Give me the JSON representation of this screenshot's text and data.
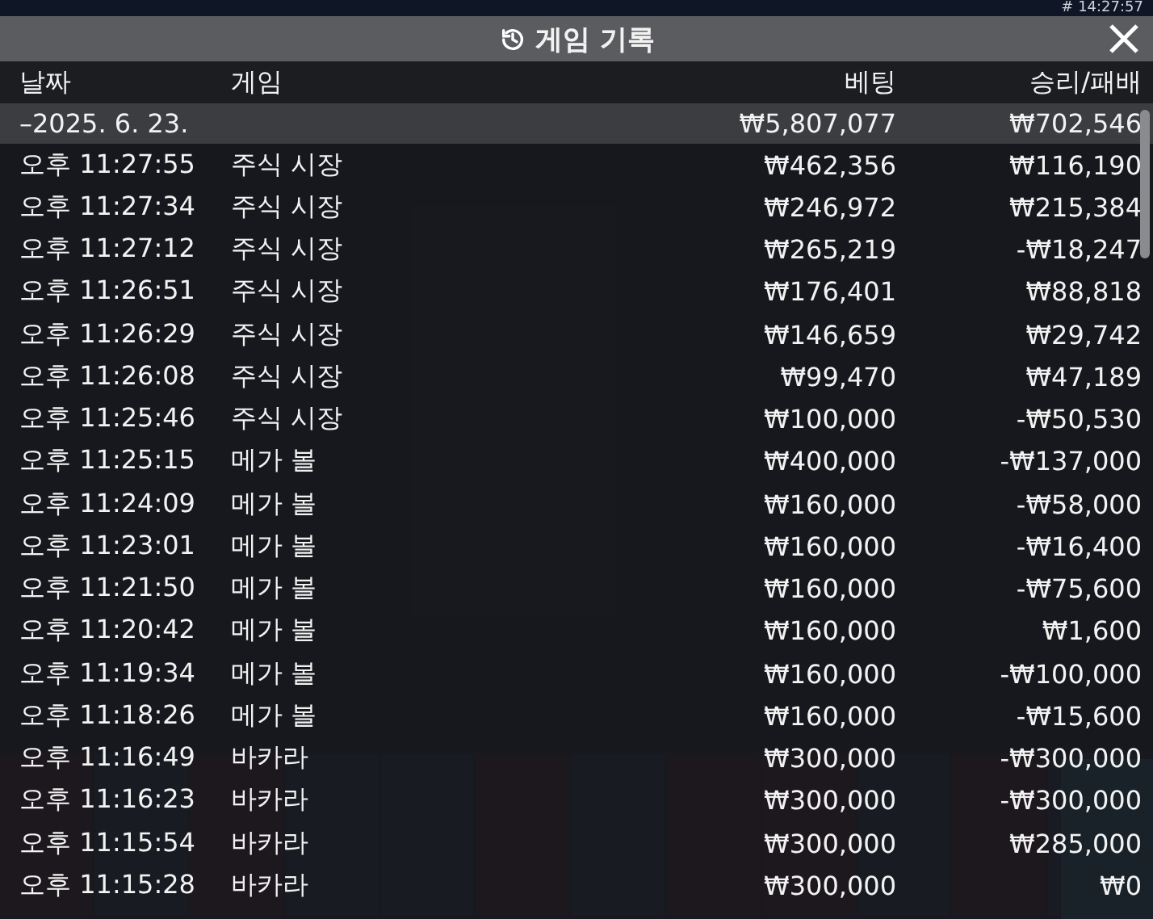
{
  "clock": "# 14:27:57",
  "window": {
    "title": "게임 기록"
  },
  "table": {
    "columns": [
      "날짜",
      "게임",
      "베팅",
      "승리/패배"
    ],
    "summary": {
      "date": "–2025. 6. 23.",
      "bet": "₩5,807,077",
      "result": "₩702,546"
    },
    "rows": [
      {
        "time": "오후 11:27:55",
        "game": "주식 시장",
        "bet": "₩462,356",
        "result": "₩116,190"
      },
      {
        "time": "오후 11:27:34",
        "game": "주식 시장",
        "bet": "₩246,972",
        "result": "₩215,384"
      },
      {
        "time": "오후 11:27:12",
        "game": "주식 시장",
        "bet": "₩265,219",
        "result": "-₩18,247"
      },
      {
        "time": "오후 11:26:51",
        "game": "주식 시장",
        "bet": "₩176,401",
        "result": "₩88,818"
      },
      {
        "time": "오후 11:26:29",
        "game": "주식 시장",
        "bet": "₩146,659",
        "result": "₩29,742"
      },
      {
        "time": "오후 11:26:08",
        "game": "주식 시장",
        "bet": "₩99,470",
        "result": "₩47,189"
      },
      {
        "time": "오후 11:25:46",
        "game": "주식 시장",
        "bet": "₩100,000",
        "result": "-₩50,530"
      },
      {
        "time": "오후 11:25:15",
        "game": "메가 볼",
        "bet": "₩400,000",
        "result": "-₩137,000"
      },
      {
        "time": "오후 11:24:09",
        "game": "메가 볼",
        "bet": "₩160,000",
        "result": "-₩58,000"
      },
      {
        "time": "오후 11:23:01",
        "game": "메가 볼",
        "bet": "₩160,000",
        "result": "-₩16,400"
      },
      {
        "time": "오후 11:21:50",
        "game": "메가 볼",
        "bet": "₩160,000",
        "result": "-₩75,600"
      },
      {
        "time": "오후 11:20:42",
        "game": "메가 볼",
        "bet": "₩160,000",
        "result": "₩1,600"
      },
      {
        "time": "오후 11:19:34",
        "game": "메가 볼",
        "bet": "₩160,000",
        "result": "-₩100,000"
      },
      {
        "time": "오후 11:18:26",
        "game": "메가 볼",
        "bet": "₩160,000",
        "result": "-₩15,600"
      },
      {
        "time": "오후 11:16:49",
        "game": "바카라",
        "bet": "₩300,000",
        "result": "-₩300,000"
      },
      {
        "time": "오후 11:16:23",
        "game": "바카라",
        "bet": "₩300,000",
        "result": "-₩300,000"
      },
      {
        "time": "오후 11:15:54",
        "game": "바카라",
        "bet": "₩300,000",
        "result": "₩285,000"
      },
      {
        "time": "오후 11:15:28",
        "game": "바카라",
        "bet": "₩300,000",
        "result": "₩0"
      }
    ]
  }
}
